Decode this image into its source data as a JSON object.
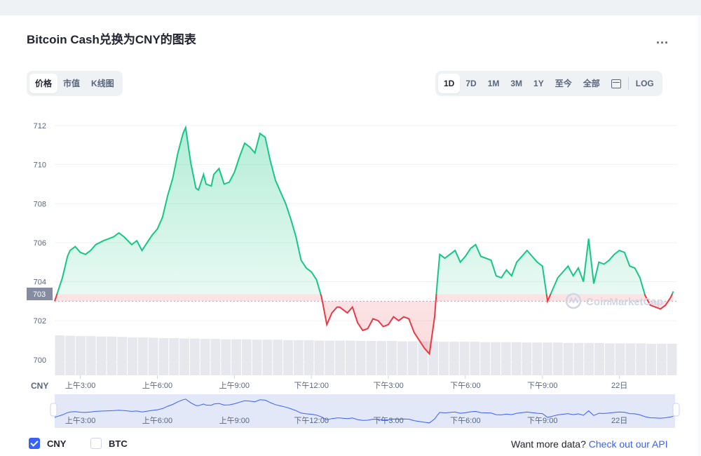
{
  "header": {
    "title": "Bitcoin Cash兑换为CNY的图表",
    "more_label": "..."
  },
  "tabs_left": [
    {
      "label": "价格",
      "active": true
    },
    {
      "label": "市值",
      "active": false
    },
    {
      "label": "K线图",
      "active": false
    }
  ],
  "tabs_right": [
    {
      "label": "1D",
      "active": true
    },
    {
      "label": "7D",
      "active": false
    },
    {
      "label": "1M",
      "active": false
    },
    {
      "label": "3M",
      "active": false
    },
    {
      "label": "1Y",
      "active": false
    },
    {
      "label": "至今",
      "active": false
    },
    {
      "label": "全部",
      "active": false
    }
  ],
  "log_label": "LOG",
  "watermark": "CoinMarketCap",
  "legend": {
    "items": [
      {
        "label": "CNY",
        "checked": true
      },
      {
        "label": "BTC",
        "checked": false
      }
    ]
  },
  "api": {
    "prefix": "Want more data? ",
    "link": "Check out our API"
  },
  "colors": {
    "up": "#16c784",
    "down": "#ea3943",
    "accent": "#3861fb"
  },
  "chart_data": {
    "type": "area",
    "currency_label": "CNY",
    "baseline": 703,
    "baseline_label": "703",
    "y_ticks": [
      700,
      702,
      704,
      706,
      708,
      710,
      712
    ],
    "ylim": [
      699.2,
      712.9
    ],
    "xlim": [
      0,
      24.25
    ],
    "x_ticks": [
      {
        "x": 1,
        "label": "上午3:00"
      },
      {
        "x": 4,
        "label": "上午6:00"
      },
      {
        "x": 7,
        "label": "上午9:00"
      },
      {
        "x": 10,
        "label": "下午12:00"
      },
      {
        "x": 13,
        "label": "下午3:00"
      },
      {
        "x": 16,
        "label": "下午6:00"
      },
      {
        "x": 19,
        "label": "下午9:00"
      },
      {
        "x": 22,
        "label": "22日"
      }
    ],
    "series": [
      {
        "x": [
          0,
          0.1,
          0.3,
          0.5,
          0.6,
          0.8,
          1.0,
          1.2,
          1.4,
          1.6,
          1.9,
          2.1,
          2.3,
          2.5,
          2.7,
          3.0,
          3.2,
          3.4,
          3.6,
          3.8,
          4.0,
          4.2,
          4.4,
          4.6,
          4.8,
          5.0,
          5.1,
          5.3,
          5.5,
          5.6,
          5.8,
          5.9,
          6.1,
          6.2,
          6.4,
          6.6,
          6.8,
          7.0,
          7.2,
          7.4,
          7.6,
          7.8,
          8.0,
          8.2,
          8.4,
          8.6,
          8.8,
          9.0,
          9.2,
          9.4,
          9.6,
          9.8,
          10.0,
          10.2,
          10.4,
          10.6,
          10.8,
          11.0,
          11.1,
          11.2,
          11.4,
          11.6,
          11.8,
          12.0,
          12.2,
          12.4,
          12.6,
          12.8,
          13.0,
          13.2,
          13.4,
          13.6,
          13.8,
          14.0,
          14.2,
          14.4,
          14.6,
          14.8,
          14.9,
          15.0,
          15.2,
          15.4,
          15.6,
          15.8,
          16.0,
          16.2,
          16.4,
          16.6,
          16.8,
          17.0,
          17.2,
          17.4,
          17.6,
          17.8,
          18.0,
          18.2,
          18.4,
          18.6,
          18.8,
          19.0,
          19.2,
          19.4,
          19.6,
          19.8,
          20.0,
          20.2,
          20.4,
          20.6,
          20.8,
          21.0,
          21.2,
          21.4,
          21.6,
          21.8,
          22.0,
          22.2,
          22.4,
          22.6,
          22.8,
          23.0,
          23.2,
          23.4,
          23.6,
          23.8,
          24.0,
          24.1
        ],
        "values": [
          703.0,
          703.4,
          704.2,
          705.3,
          705.6,
          705.8,
          705.5,
          705.4,
          705.6,
          705.9,
          706.1,
          706.2,
          706.3,
          706.5,
          706.3,
          705.9,
          706.1,
          705.6,
          706.0,
          706.4,
          706.7,
          707.3,
          708.4,
          709.3,
          710.6,
          711.6,
          711.9,
          710.1,
          708.8,
          708.7,
          709.5,
          709.0,
          708.9,
          709.5,
          709.8,
          709.0,
          709.1,
          709.6,
          710.4,
          711.1,
          710.9,
          710.6,
          711.6,
          711.4,
          710.2,
          709.2,
          708.6,
          708.0,
          707.2,
          706.3,
          705.1,
          704.7,
          704.5,
          704.1,
          703.2,
          701.8,
          702.4,
          702.7,
          702.7,
          702.6,
          702.4,
          702.7,
          701.9,
          701.5,
          701.6,
          702.1,
          702.0,
          701.7,
          701.8,
          702.2,
          702.0,
          702.2,
          702.1,
          701.4,
          701.0,
          700.6,
          700.3,
          702.2,
          703.9,
          705.4,
          705.2,
          705.4,
          705.6,
          705.0,
          705.3,
          705.7,
          705.9,
          705.3,
          705.2,
          705.1,
          704.3,
          704.2,
          704.6,
          704.3,
          705.0,
          705.3,
          705.6,
          705.3,
          705.0,
          704.8,
          703.0,
          703.6,
          704.2,
          704.5,
          704.8,
          704.3,
          704.7,
          704.0,
          706.2,
          703.9,
          705.0,
          704.9,
          705.1,
          705.4,
          705.6,
          705.5,
          704.8,
          704.7,
          704.2,
          703.3,
          702.8,
          702.7,
          702.6,
          702.8,
          703.2,
          703.5
        ]
      }
    ],
    "volume": [
      1.0,
      0.99,
      0.98,
      0.98,
      0.97,
      0.97,
      0.96,
      0.95,
      0.95,
      0.94,
      0.93,
      0.93,
      0.92,
      0.92,
      0.91,
      0.91,
      0.9,
      0.9,
      0.9,
      0.89,
      0.89,
      0.89,
      0.88,
      0.88,
      0.88,
      0.87,
      0.87,
      0.87,
      0.87,
      0.86,
      0.86,
      0.86,
      0.86,
      0.85,
      0.85,
      0.85,
      0.85,
      0.84,
      0.84,
      0.84,
      0.84,
      0.83,
      0.83,
      0.83,
      0.83,
      0.82,
      0.82,
      0.82,
      0.82,
      0.81,
      0.81,
      0.81,
      0.81,
      0.8,
      0.8,
      0.8,
      0.8,
      0.79,
      0.79,
      0.79
    ],
    "navigator_labels": [
      "上午3:00",
      "上午6:00",
      "上午9:00",
      "下午12:00",
      "下午3:00",
      "下午6:00",
      "下午9:00",
      "22日"
    ]
  }
}
